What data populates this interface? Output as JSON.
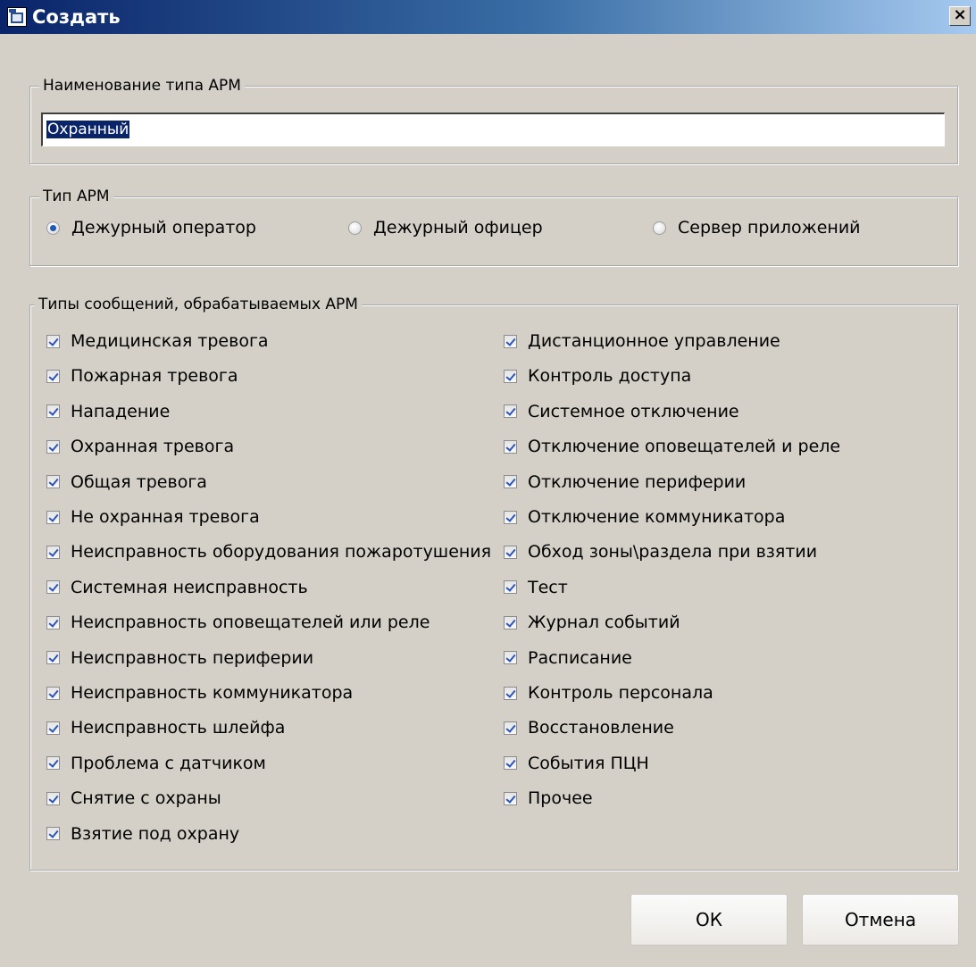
{
  "window": {
    "title": "Создать",
    "close_glyph": "×"
  },
  "name_group": {
    "legend": "Наименование типа АРМ",
    "value": "Охранный"
  },
  "type_group": {
    "legend": "Тип АРМ",
    "options": [
      {
        "label": "Дежурный оператор",
        "checked": true
      },
      {
        "label": "Дежурный офицер",
        "checked": false
      },
      {
        "label": "Сервер приложений",
        "checked": false
      }
    ]
  },
  "messages_group": {
    "legend": "Типы сообщений, обрабатываемых АРМ",
    "left": [
      "Медицинская тревога",
      "Пожарная тревога",
      "Нападение",
      "Охранная тревога",
      "Общая тревога",
      "Не охранная тревога",
      "Неисправность оборудования пожаротушения",
      "Системная неисправность",
      "Неисправность оповещателей или реле",
      "Неисправность периферии",
      "Неисправность коммуникатора",
      "Неисправность шлейфа",
      "Проблема с датчиком",
      "Снятие с охраны",
      "Взятие под охрану"
    ],
    "right": [
      "Дистанционное управление",
      "Контроль доступа",
      "Системное отключение",
      "Отключение оповещателей и реле",
      "Отключение периферии",
      "Отключение коммуникатора",
      "Обход зоны\\раздела при взятии",
      "Тест",
      "Журнал событий",
      "Расписание",
      "Контроль персонала",
      "Восстановление",
      "События ПЦН",
      "Прочее"
    ]
  },
  "buttons": {
    "ok": "ОК",
    "cancel": "Отмена"
  },
  "colors": {
    "title_start": "#0a246a",
    "title_end": "#a6caf0",
    "check": "#2a54b8",
    "dialog_bg": "#d4d0c8"
  }
}
